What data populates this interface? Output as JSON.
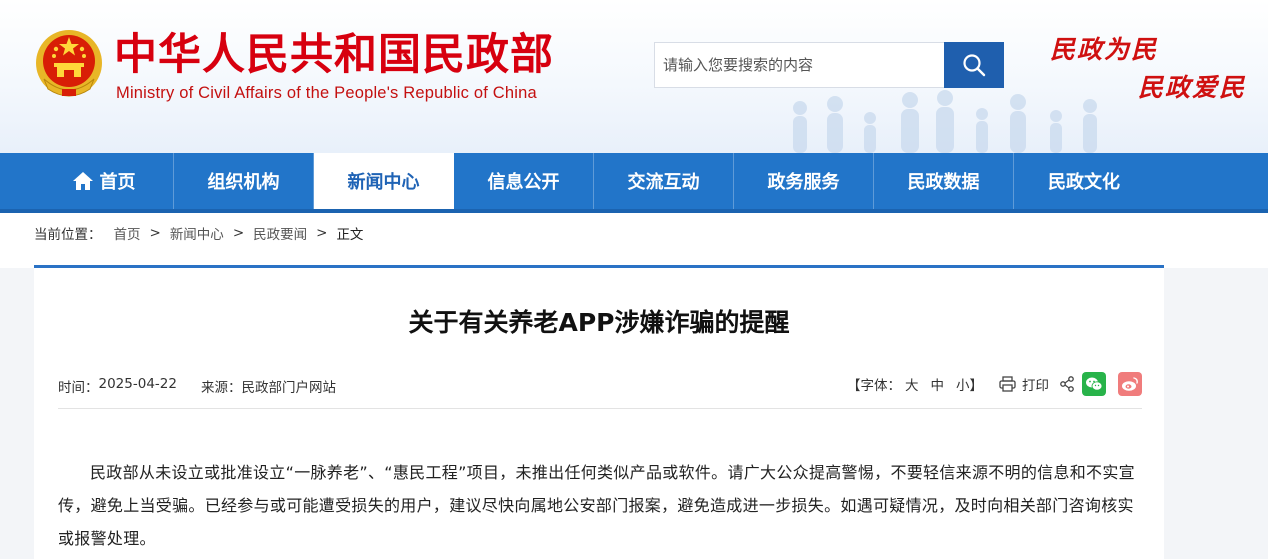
{
  "header": {
    "title_cn": "中华人民共和国民政部",
    "title_en": "Ministry of Civil Affairs of the People's Republic of China",
    "slogan_line1": "民政为民",
    "slogan_line2": "民政爱民",
    "emblem_icon": "national-emblem-icon",
    "brand_red": "#d7000f"
  },
  "search": {
    "placeholder": "请输入您要搜索的内容",
    "value": "",
    "button_icon": "search-icon"
  },
  "nav": {
    "items": [
      {
        "label": "首页",
        "icon": "home-icon",
        "active": false
      },
      {
        "label": "组织机构",
        "active": false
      },
      {
        "label": "新闻中心",
        "active": true
      },
      {
        "label": "信息公开",
        "active": false
      },
      {
        "label": "交流互动",
        "active": false
      },
      {
        "label": "政务服务",
        "active": false
      },
      {
        "label": "民政数据",
        "active": false
      },
      {
        "label": "民政文化",
        "active": false
      }
    ],
    "bar_color": "#2275c9"
  },
  "breadcrumb": {
    "prefix": "当前位置：",
    "items": [
      "首页",
      "新闻中心",
      "民政要闻",
      "正文"
    ],
    "separator": ">"
  },
  "article": {
    "title": "关于有关养老APP涉嫌诈骗的提醒",
    "time_label": "时间：",
    "time_value": "2025-04-22",
    "source_label": "来源：",
    "source_value": "民政部门户网站",
    "font_size_open": "【字体：",
    "font_size_options": [
      "大",
      "中",
      "小"
    ],
    "font_size_close": "】",
    "print_label": "打印",
    "share_icons": [
      "share-icon",
      "wechat-icon",
      "weibo-icon"
    ],
    "body": "民政部从未设立或批准设立“一脉养老”、“惠民工程”项目，未推出任何类似产品或软件。请广大公众提高警惕，不要轻信来源不明的信息和不实宣传，避免上当受骗。已经参与或可能遭受损失的用户，建议尽快向属地公安部门报案，避免造成进一步损失。如遇可疑情况，及时向相关部门咨询核实或报警处理。"
  }
}
